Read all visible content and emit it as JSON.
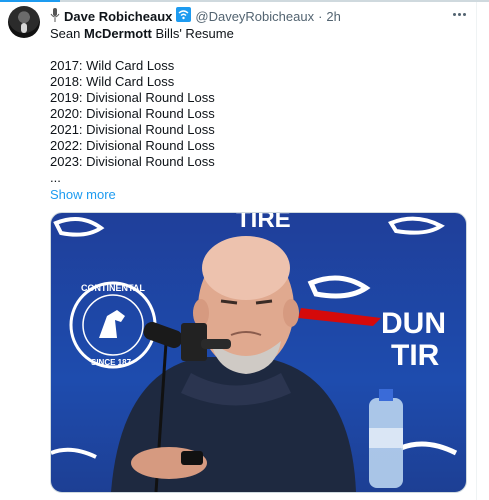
{
  "author": {
    "name": "Dave Robicheaux",
    "handle": "@DaveyRobicheaux",
    "separator": "·",
    "time": "2h",
    "icons": [
      "microphone-emoji",
      "wifi-emoji"
    ]
  },
  "tweet": {
    "title_prefix": "Sean ",
    "title_bold": "McDermott",
    "title_suffix": " Bills' Resume",
    "lines": [
      "2017: Wild Card Loss",
      "2018: Wild Card Loss",
      "2019: Divisional Round Loss",
      "2020: Divisional Round Loss",
      "2021: Divisional Round Loss",
      "2022: Divisional Round Loss",
      "2023: Divisional Round Loss",
      "..."
    ],
    "show_more": "Show more"
  },
  "media": {
    "backdrop_text_top": "TIRE",
    "backdrop_text_right_1": "DUN",
    "backdrop_text_right_2": "TIR",
    "seal_top": "CONTINENTAL",
    "seal_bottom": "SINCE 187"
  },
  "colors": {
    "accent": "#1d9bf0",
    "backdrop": "#1e4cae",
    "text": "#0f1419",
    "muted": "#536471"
  }
}
